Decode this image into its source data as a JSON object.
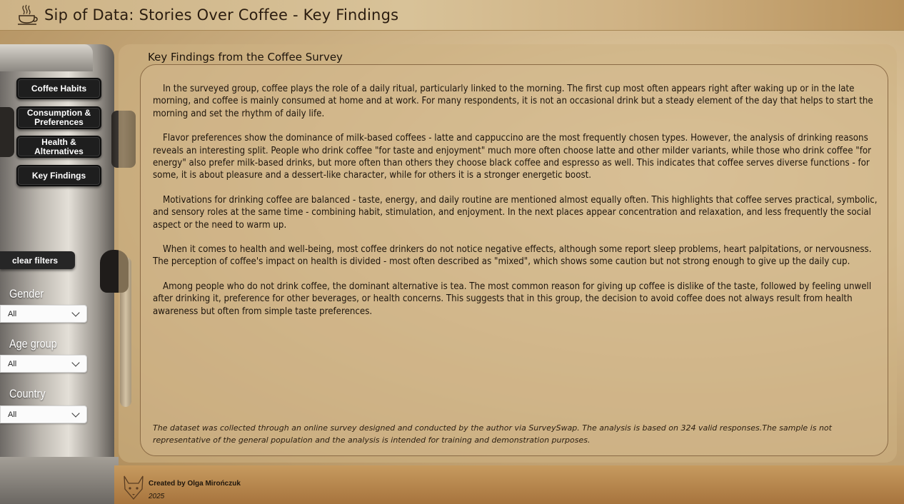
{
  "header": {
    "title": "Sip of Data: Stories Over Coffee - Key Findings",
    "logo_icon": "coffee-cup-icon"
  },
  "nav": {
    "items": [
      {
        "label": "Coffee Habits"
      },
      {
        "label": "Consumption & Preferences"
      },
      {
        "label": "Health & Alternatives"
      },
      {
        "label": "Key Findings"
      }
    ]
  },
  "filters": {
    "clear_label": "clear filters",
    "gender": {
      "label": "Gender",
      "value": "All"
    },
    "age_group": {
      "label": "Age group",
      "value": "All"
    },
    "country": {
      "label": "Country",
      "value": "All"
    }
  },
  "main": {
    "title": "Key Findings from the Coffee Survey",
    "paragraphs": [
      "In the surveyed group, coffee plays the role of a daily ritual, particularly linked to the morning. The first cup most often appears right after waking up or in the late morning, and coffee is mainly consumed at home and at work. For many respondents, it is not an occasional drink but a steady element of the day that helps to start the morning and set the rhythm of daily life.",
      "Flavor preferences show the dominance of milk-based coffees - latte and cappuccino are the most frequently chosen types. However, the analysis of drinking reasons reveals an interesting split. People who drink coffee \"for taste and enjoyment\" much more often choose latte and other milder variants, while those who drink coffee \"for energy\" also prefer milk-based drinks, but more often than others they choose black coffee and espresso as well. This indicates that coffee serves diverse functions - for some, it is about pleasure and a dessert-like character, while for others it is a stronger energetic boost.",
      "Motivations for drinking coffee are balanced - taste, energy, and daily routine are mentioned almost equally often. This highlights that coffee serves practical, symbolic, and sensory roles at the same time - combining habit, stimulation, and enjoyment. In the next places appear concentration and relaxation, and less frequently the social aspect or the need to warm up.",
      "When it comes to health and well-being, most coffee drinkers do not notice negative effects, although some report sleep problems, heart palpitations, or nervousness. The perception of coffee's impact on health is divided - most often described as \"mixed\", which shows some caution but not strong enough to give up the daily cup.",
      "Among people who do not drink coffee, the dominant alternative is tea. The most common reason for giving up coffee is dislike of the taste, followed by feeling unwell after drinking it, preference for other beverages, or health concerns. This suggests that in this group, the decision to avoid coffee does not always result from health awareness but often from simple taste preferences."
    ],
    "disclaimer": "The dataset was collected through an online survey designed and conducted by the author via SurveySwap. The analysis is based on 324 valid responses.The sample is not representative of the general population and the analysis is intended for training and demonstration purposes."
  },
  "footer": {
    "creator": "Created by Olga Mirończuk",
    "year": "2025",
    "logo_icon": "fox-logo-icon"
  }
}
